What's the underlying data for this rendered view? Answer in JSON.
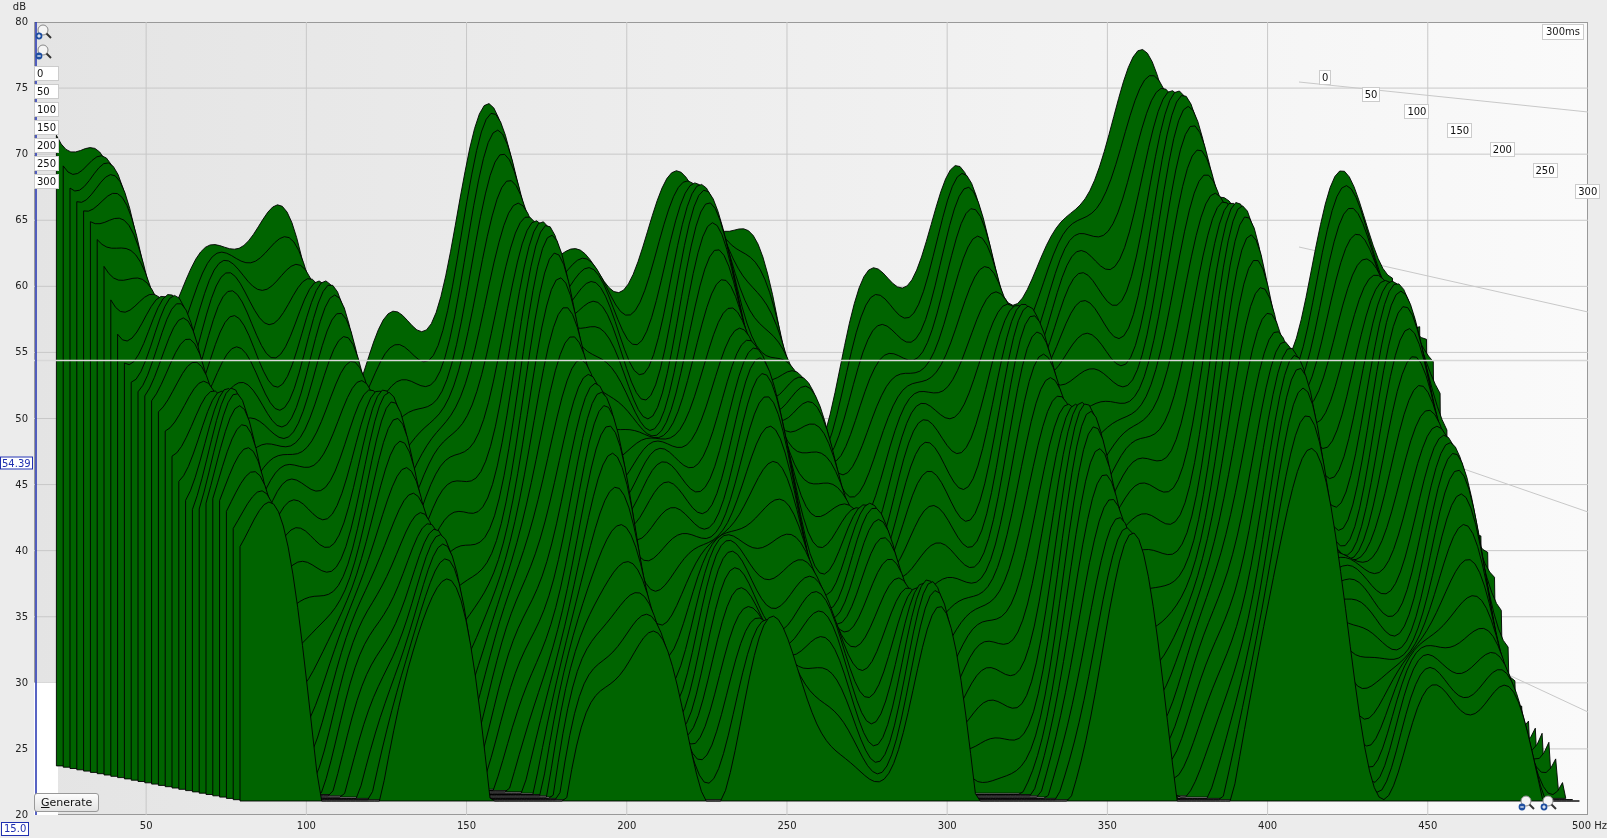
{
  "y_axis": {
    "unit": "dB",
    "ticks": [
      "80",
      "75",
      "70",
      "65",
      "60",
      "55",
      "50",
      "45",
      "40",
      "35",
      "30",
      "25",
      "20"
    ]
  },
  "x_axis": {
    "ticks": [
      "50",
      "100",
      "150",
      "200",
      "250",
      "300",
      "350",
      "400",
      "450"
    ],
    "end_label": "500 Hz"
  },
  "cursor": {
    "y_value": "54.39",
    "x_value": "15.0"
  },
  "time_axis": {
    "left_ticks": [
      "0",
      "50",
      "100",
      "150",
      "200",
      "250",
      "300"
    ],
    "slanted_ticks": [
      "0",
      "50",
      "100",
      "150",
      "200",
      "250",
      "300"
    ],
    "end_label": "300ms"
  },
  "generate_button": {
    "label": "Generate"
  }
}
